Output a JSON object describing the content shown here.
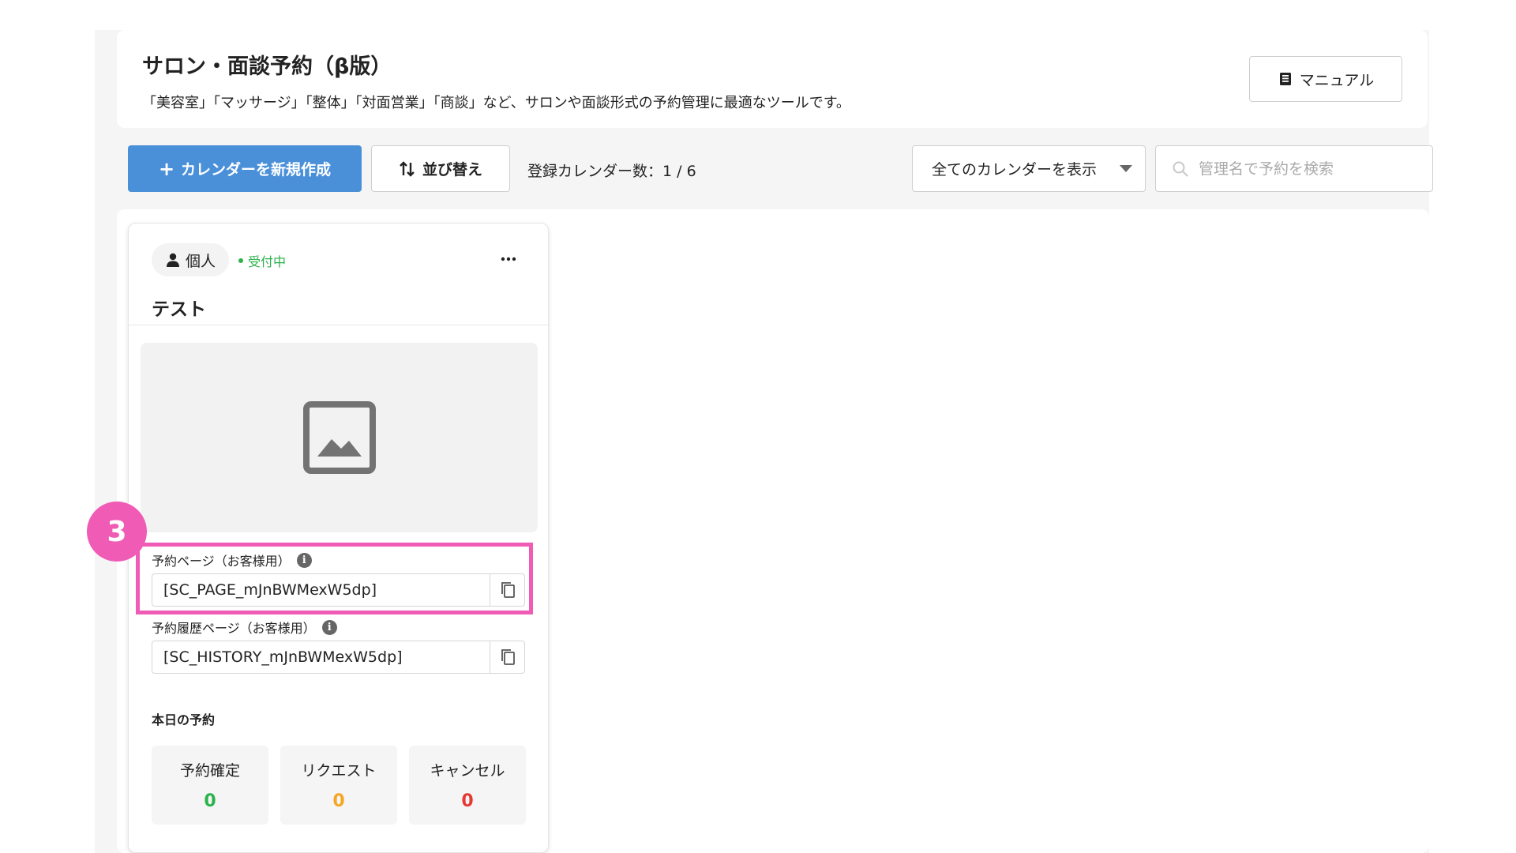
{
  "header": {
    "title": "サロン・面談予約（β版）",
    "description": "「美容室」「マッサージ」「整体」「対面営業」「商談」など、サロンや面談形式の予約管理に最適なツールです。",
    "manual_label": "マニュアル"
  },
  "toolbar": {
    "create_label": "カレンダーを新規作成",
    "sort_label": "並び替え",
    "count_text": "登録カレンダー数：1 / 6",
    "filter_selected": "全てのカレンダーを表示",
    "search_placeholder": "管理名で予約を検索"
  },
  "calendar_card": {
    "type_label": "個人",
    "status_label": "受付中",
    "name": "テスト",
    "step_number": "3",
    "booking_page": {
      "label": "予約ページ（お客様用）",
      "value": "[SC_PAGE_mJnBWMexW5dp]"
    },
    "history_page": {
      "label": "予約履歴ページ（お客様用）",
      "value": "[SC_HISTORY_mJnBWMexW5dp]"
    },
    "today_label": "本日の予約",
    "stats": [
      {
        "label": "予約確定",
        "value": "0",
        "color": "#2bb24c"
      },
      {
        "label": "リクエスト",
        "value": "0",
        "color": "#f5a623"
      },
      {
        "label": "キャンセル",
        "value": "0",
        "color": "#e53935"
      }
    ]
  },
  "colors": {
    "primary": "#4a90d9",
    "highlight": "#f05bb5",
    "status_green": "#2bb24c"
  }
}
